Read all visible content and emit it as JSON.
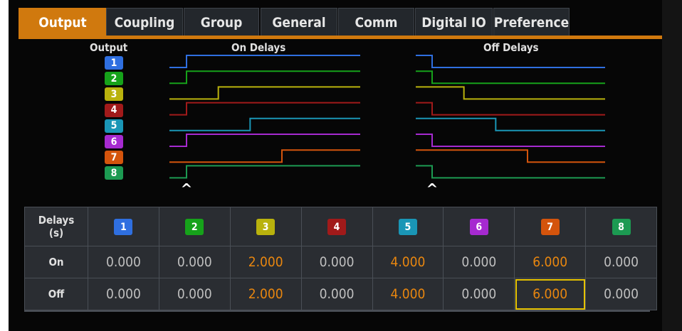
{
  "tabs": [
    {
      "label": "Output",
      "active": true
    },
    {
      "label": "Coupling",
      "active": false
    },
    {
      "label": "Group",
      "active": false
    },
    {
      "label": "General",
      "active": false
    },
    {
      "label": "Comm",
      "active": false
    },
    {
      "label": "Digital IO",
      "active": false
    },
    {
      "label": "Preference",
      "active": false
    }
  ],
  "diagram": {
    "output_label": "Output",
    "on_title": "On Delays",
    "off_title": "Off Delays",
    "marker_glyph": "^"
  },
  "channels": [
    {
      "label": "1",
      "color": "#2f6fe0",
      "on": "0.000",
      "off": "0.000"
    },
    {
      "label": "2",
      "color": "#16a21a",
      "on": "0.000",
      "off": "0.000"
    },
    {
      "label": "3",
      "color": "#b9b20d",
      "on": "2.000",
      "off": "2.000"
    },
    {
      "label": "4",
      "color": "#a11a1a",
      "on": "0.000",
      "off": "0.000"
    },
    {
      "label": "5",
      "color": "#1a96b6",
      "on": "4.000",
      "off": "4.000"
    },
    {
      "label": "6",
      "color": "#a62ad0",
      "on": "0.000",
      "off": "0.000"
    },
    {
      "label": "7",
      "color": "#d4540c",
      "on": "6.000",
      "off": "6.000"
    },
    {
      "label": "8",
      "color": "#1c9a52",
      "on": "0.000",
      "off": "0.000"
    }
  ],
  "table": {
    "header_line1": "Delays",
    "header_line2": "(s)",
    "on_label": "On",
    "off_label": "Off",
    "selected": {
      "row": "off",
      "channel": 7
    }
  }
}
